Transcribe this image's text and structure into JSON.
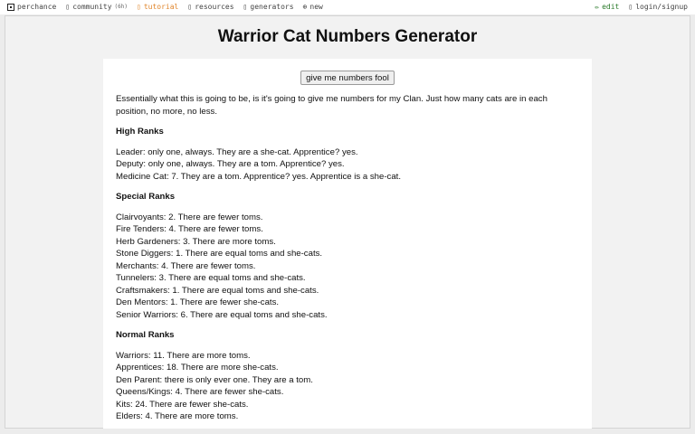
{
  "topbar": {
    "left": [
      {
        "label": "perchance",
        "icon": "logo-icon"
      },
      {
        "label": "community",
        "small": "(6h)",
        "icon": "chat-icon"
      },
      {
        "label": "tutorial",
        "icon": "book-icon"
      },
      {
        "label": "resources",
        "icon": "folder-icon"
      },
      {
        "label": "generators",
        "icon": "list-icon"
      },
      {
        "label": "new",
        "icon": "plus-circle-icon"
      }
    ],
    "right": [
      {
        "label": "edit",
        "icon": "pencil-icon"
      },
      {
        "label": "login/signup",
        "icon": "user-icon"
      }
    ],
    "active_color": "#e0852b",
    "edit_color": "#2a7a2a"
  },
  "page": {
    "title": "Warrior Cat Numbers Generator",
    "button_label": "give me numbers fool",
    "intro": "Essentially what this is going to be, is it's going to give me numbers for my Clan. Just how many cats are in each position, no more, no less.",
    "sections": [
      {
        "heading": "High Ranks",
        "lines": [
          "Leader: only one, always. They are a she-cat. Apprentice? yes.",
          "Deputy: only one, always. They are a tom. Apprentice? yes.",
          "Medicine Cat: 7. They are a tom. Apprentice? yes. Apprentice is a she-cat."
        ]
      },
      {
        "heading": "Special Ranks",
        "lines": [
          "Clairvoyants: 2. There are fewer toms.",
          "Fire Tenders: 4. There are fewer toms.",
          "Herb Gardeners: 3. There are more toms.",
          "Stone Diggers: 1. There are equal toms and she-cats.",
          "Merchants: 4. There are fewer toms.",
          "Tunnelers: 3. There are equal toms and she-cats.",
          "Craftsmakers: 1. There are equal toms and she-cats.",
          "Den Mentors: 1. There are fewer she-cats.",
          "Senior Warriors: 6. There are equal toms and she-cats."
        ]
      },
      {
        "heading": "Normal Ranks",
        "lines": [
          "Warriors: 11. There are more toms.",
          "Apprentices: 18. There are more she-cats.",
          "Den Parent: there is only ever one. They are a tom.",
          "Queens/Kings: 4. There are fewer she-cats.",
          "Kits: 24. There are fewer she-cats.",
          "Elders: 4. There are more toms."
        ]
      }
    ]
  }
}
